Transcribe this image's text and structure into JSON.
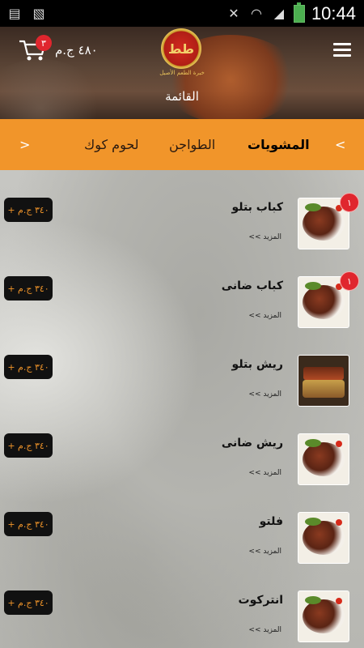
{
  "status_bar": {
    "time": "10:44",
    "icons": [
      "sim-icon",
      "image-icon",
      "mute-icon",
      "wifi-icon",
      "signal-icon",
      "battery-icon"
    ]
  },
  "header": {
    "cart_count": "٣",
    "cart_total": "٤٨٠ ج.م",
    "logo_text": "طط",
    "logo_caption": "خبرة الطعم الأصيل",
    "page_title": "القائمة"
  },
  "tabs": {
    "prev_arrow": "<",
    "next_arrow": ">",
    "items": [
      {
        "label": "المشويات",
        "active": true
      },
      {
        "label": "الطواجن",
        "active": false
      },
      {
        "label": "لحوم كوك",
        "active": false
      }
    ]
  },
  "menu_items": [
    {
      "name": "كباب بتلو",
      "more": "المزيد >>",
      "price": "٣٤٠ ج.م +",
      "badge": "١"
    },
    {
      "name": "كباب ضانى",
      "more": "المزيد >>",
      "price": "٣٤٠ ج.م +",
      "badge": "١"
    },
    {
      "name": "ريش بتلو",
      "more": "المزيد >>",
      "price": "٣٤٠ ج.م +",
      "badge": ""
    },
    {
      "name": "ريش ضانى",
      "more": "المزيد >>",
      "price": "٣٤٠ ج.م +",
      "badge": ""
    },
    {
      "name": "فلتو",
      "more": "المزيد >>",
      "price": "٣٤٠ ج.م +",
      "badge": ""
    },
    {
      "name": "انتركوت",
      "more": "المزيد >>",
      "price": "٣٤٠ ج.م +",
      "badge": ""
    }
  ],
  "colors": {
    "accent": "#f1952a",
    "badge": "#e0262e",
    "button_bg": "#111111"
  }
}
